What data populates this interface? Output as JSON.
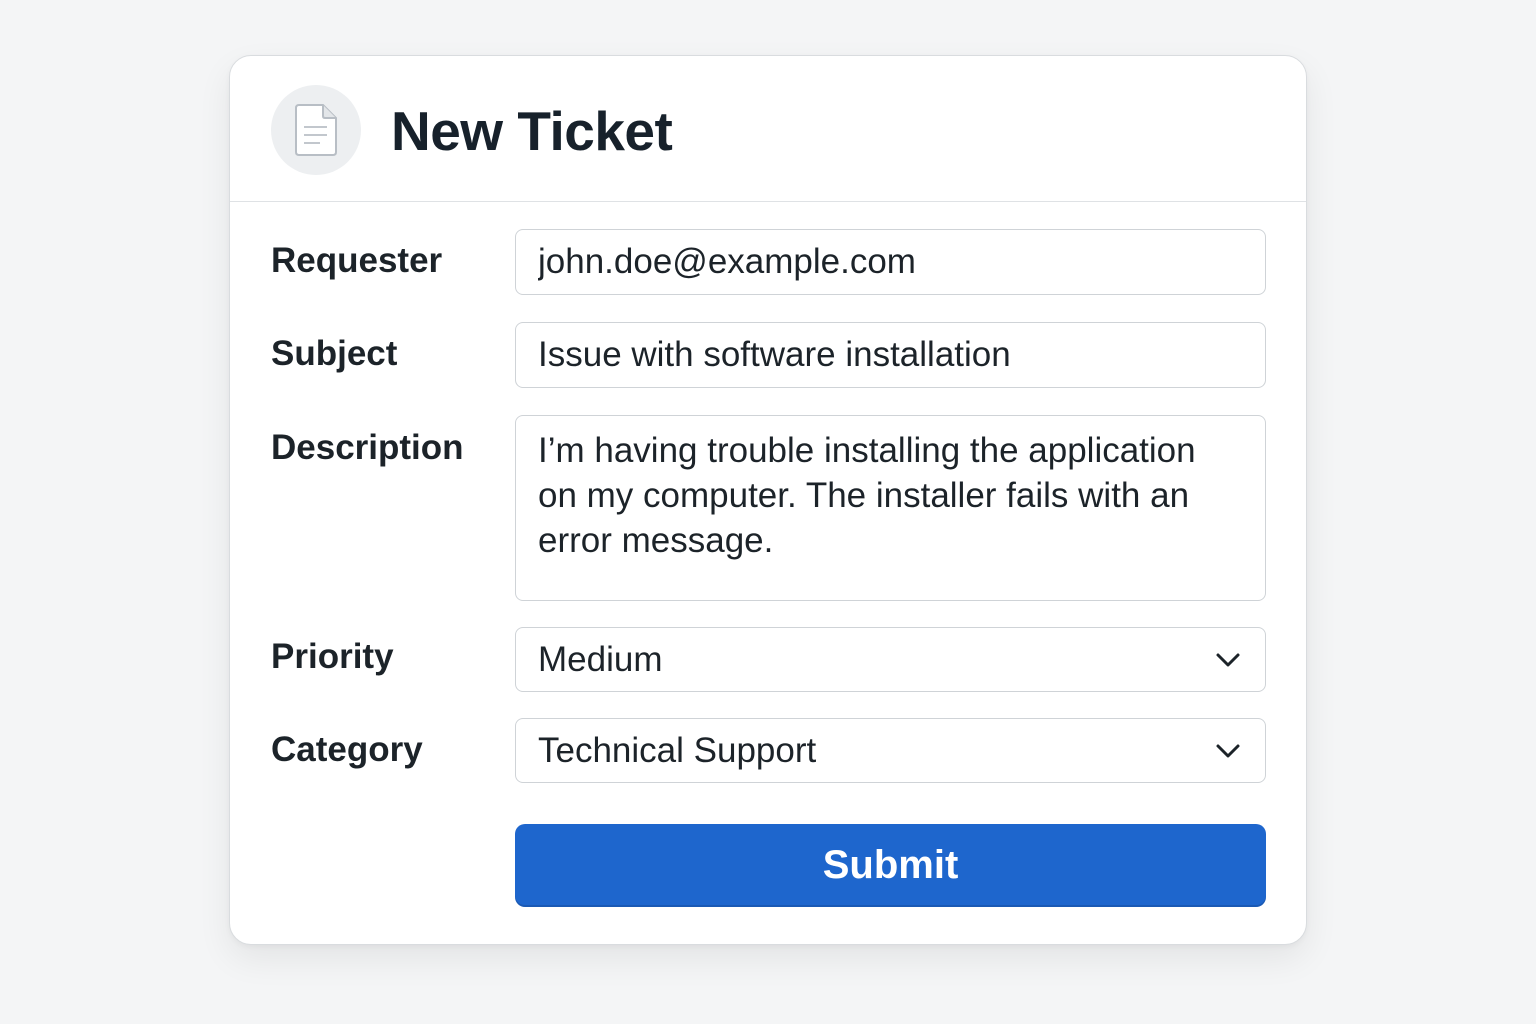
{
  "header": {
    "icon": "document-icon",
    "title": "New Ticket"
  },
  "form": {
    "requester": {
      "label": "Requester",
      "value": "john.doe@example.com"
    },
    "subject": {
      "label": "Subject",
      "value": "Issue with software installation"
    },
    "description": {
      "label": "Description",
      "value": "I’m having trouble installing the application on my computer. The installer fails with an error message."
    },
    "priority": {
      "label": "Priority",
      "selected": "Medium",
      "icon": "chevron-down-icon"
    },
    "category": {
      "label": "Category",
      "selected": "Technical Support",
      "icon": "chevron-down-icon"
    },
    "submit_label": "Submit"
  },
  "colors": {
    "accent": "#1e66cd",
    "background": "#f4f5f6",
    "card": "#ffffff",
    "text": "#17212b"
  }
}
